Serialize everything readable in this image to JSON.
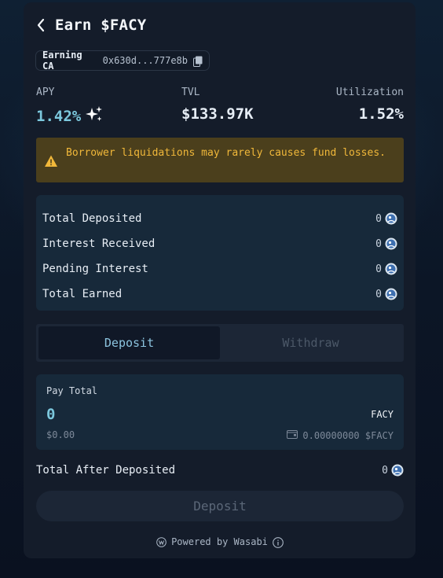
{
  "header": {
    "title": "Earn $FACY",
    "back_icon": "chevron-left-icon"
  },
  "contract": {
    "label": "Earning CA",
    "address": "0x630d...777e8b",
    "copy_icon": "copy-icon"
  },
  "stats": {
    "apy": {
      "label": "APY",
      "value": "1.42%",
      "icon": "sparkles-icon"
    },
    "tvl": {
      "label": "TVL",
      "value": "$133.97K"
    },
    "utilization": {
      "label": "Utilization",
      "value": "1.52%"
    }
  },
  "warning": {
    "icon": "warning-triangle-icon",
    "text": "Borrower liquidations may rarely causes fund losses."
  },
  "summary": {
    "rows": [
      {
        "label": "Total Deposited",
        "value": "0"
      },
      {
        "label": "Interest Received",
        "value": "0"
      },
      {
        "label": "Pending Interest",
        "value": "0"
      },
      {
        "label": "Total Earned",
        "value": "0"
      }
    ]
  },
  "tabs": {
    "active": "Deposit",
    "inactive": "Withdraw"
  },
  "pay": {
    "label": "Pay Total",
    "amount": "0",
    "token": "FACY",
    "usd": "$0.00",
    "balance": "0.00000000 $FACY",
    "wallet_icon": "wallet-icon"
  },
  "after": {
    "label": "Total After Deposited",
    "value": "0"
  },
  "deposit_button": "Deposit",
  "footer": {
    "text": "Powered by Wasabi",
    "logo_icon": "wasabi-logo-icon",
    "info_icon": "info-icon"
  },
  "colors": {
    "accent": "#7cc8dd",
    "warning_bg": "#4b3f1c",
    "warning_text": "#f1b83a",
    "card_bg": "#141c2a",
    "panel_bg": "#17293a"
  }
}
